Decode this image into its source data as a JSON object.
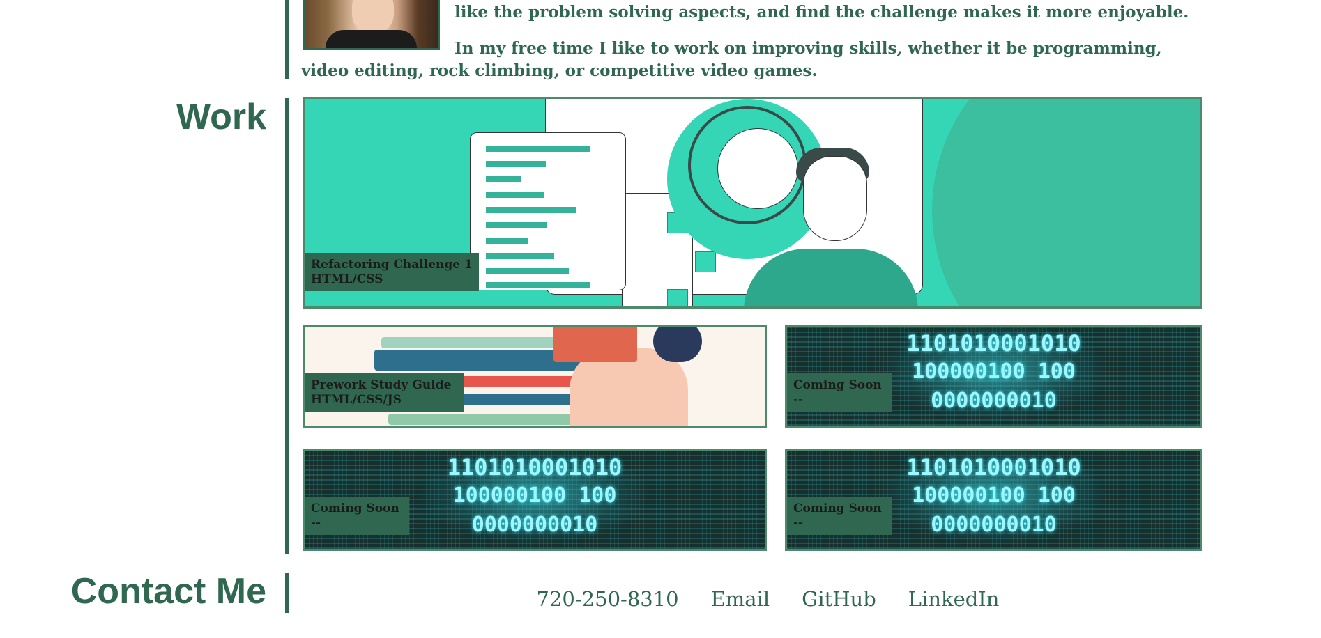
{
  "about": {
    "line1": "like the problem solving aspects, and find the challenge makes it more enjoyable.",
    "paragraph2": "In my free time I like to work on improving skills, whether it be programming, video editing, rock climbing, or competitive video games."
  },
  "work": {
    "title": "Work",
    "projects": [
      {
        "title": "Refactoring Challenge 1",
        "tech": "HTML/CSS"
      },
      {
        "title": "Prework Study Guide",
        "tech": "HTML/CSS/JS"
      },
      {
        "title": "Coming Soon",
        "tech": "--"
      },
      {
        "title": "Coming Soon",
        "tech": "--"
      },
      {
        "title": "Coming Soon",
        "tech": "--"
      }
    ],
    "binary_rows": [
      "1101010001010",
      "100000100   100",
      "0000000010"
    ]
  },
  "contact": {
    "title": "Contact Me",
    "links": [
      "720-250-8310",
      "Email",
      "GitHub",
      "LinkedIn"
    ]
  },
  "colors": {
    "brand_green": "#2f6750",
    "card_border": "#4d8a6c",
    "teal": "#34d6b6"
  }
}
